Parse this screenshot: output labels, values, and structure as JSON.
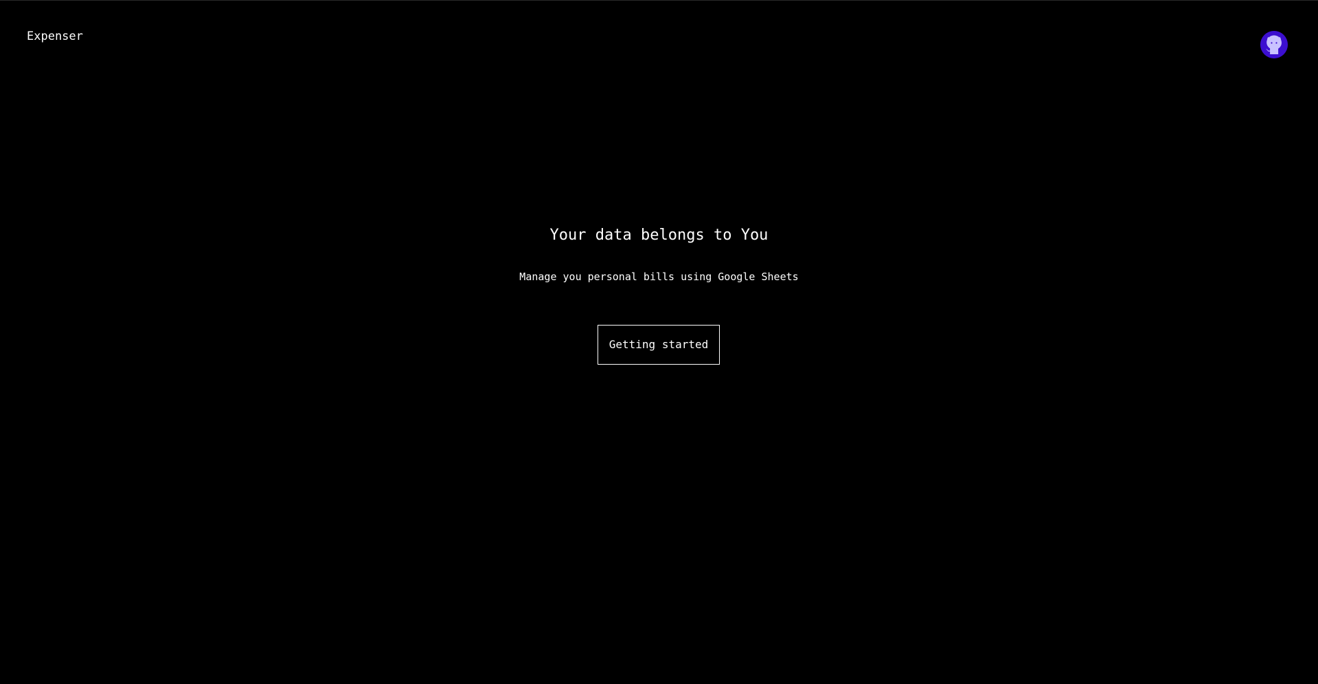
{
  "header": {
    "brand": "Expenser",
    "github_icon": "github-icon",
    "github_badge_color": "#3c0fd0"
  },
  "hero": {
    "headline": "Your data belongs to You",
    "subheadline": "Manage you personal bills using Google Sheets",
    "cta_label": "Getting started"
  },
  "colors": {
    "background": "#000000",
    "text": "#ffffff"
  }
}
